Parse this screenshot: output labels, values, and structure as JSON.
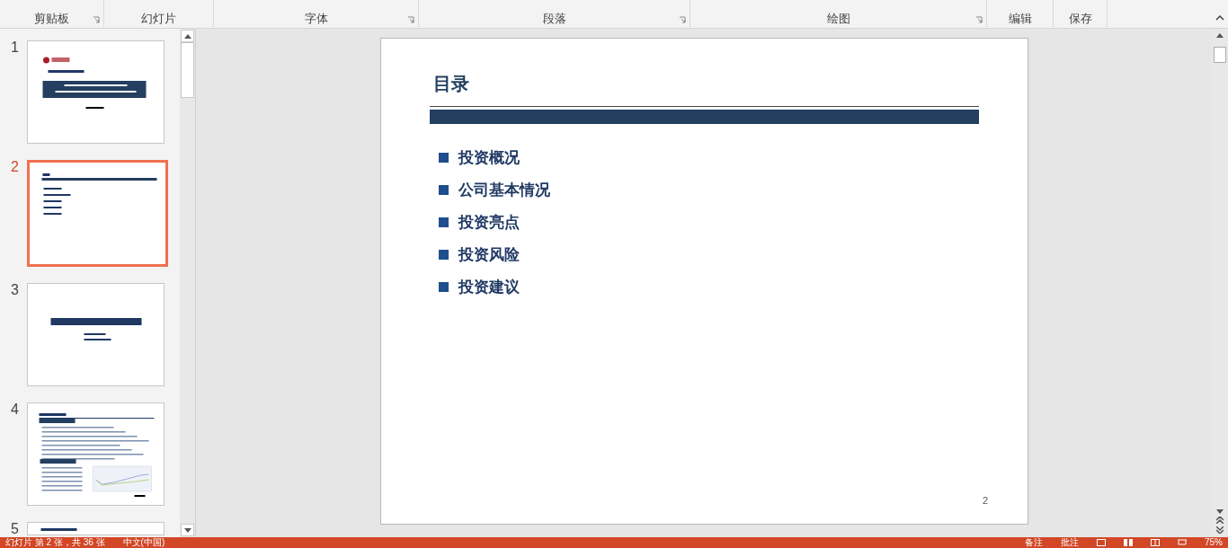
{
  "ribbon_groups": [
    {
      "label": "剪贴板",
      "launcher": true
    },
    {
      "label": "幻灯片",
      "launcher": false
    },
    {
      "label": "字体",
      "launcher": true
    },
    {
      "label": "段落",
      "launcher": true
    },
    {
      "label": "绘图",
      "launcher": true
    },
    {
      "label": "编辑",
      "launcher": false
    },
    {
      "label": "保存",
      "launcher": false
    }
  ],
  "thumbnails": [
    {
      "number": "1",
      "selected": false,
      "kind": "cover"
    },
    {
      "number": "2",
      "selected": true,
      "kind": "toc"
    },
    {
      "number": "3",
      "selected": false,
      "kind": "section"
    },
    {
      "number": "4",
      "selected": false,
      "kind": "content"
    },
    {
      "number": "5",
      "selected": false,
      "kind": "partial"
    }
  ],
  "slide": {
    "title": "目录",
    "bullets": [
      "投资概况",
      "公司基本情况",
      "投资亮点",
      "投资风险",
      "投资建议"
    ],
    "page_number": "2"
  },
  "status_bar": {
    "slide_info": "幻灯片 第 2 张，共 36 张",
    "language": "中文(中国)",
    "notes": "备注",
    "comments": "批注",
    "zoom": "75%"
  }
}
